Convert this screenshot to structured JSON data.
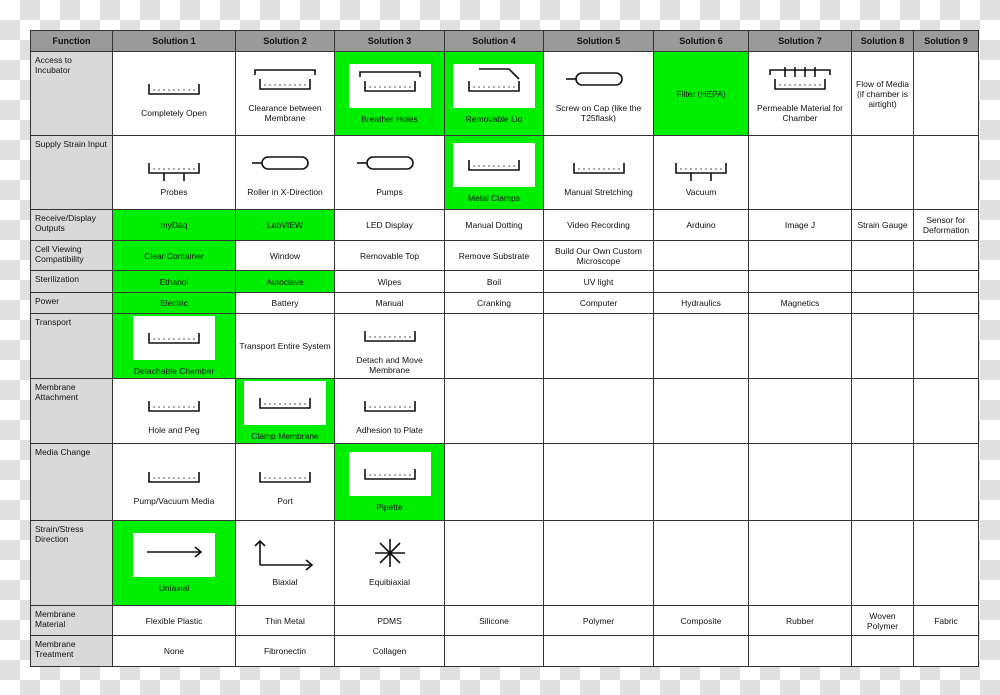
{
  "colors": {
    "selected": "#00ee00",
    "header": "#9a9a9a",
    "function_col": "#d9d9d9"
  },
  "headers": [
    "Function",
    "Solution 1",
    "Solution 2",
    "Solution 3",
    "Solution 4",
    "Solution 5",
    "Solution 6",
    "Solution 7",
    "Solution 8",
    "Solution 9"
  ],
  "rows": [
    {
      "label": "Access to Incubator",
      "cells": [
        {
          "text": "Completely Open",
          "sketch": "open-dish-icon"
        },
        {
          "text": "Clearance between Membrane",
          "sketch": "lidded-dish-icon"
        },
        {
          "text": "Breather Holes",
          "sketch": "vented-lid-dish-icon",
          "selected": true
        },
        {
          "text": "Removable Lid",
          "sketch": "hinged-lid-icon",
          "selected": true
        },
        {
          "text": "Screw on Cap (like the T25flask)",
          "sketch": "flask-icon"
        },
        {
          "text": "Filter (HEPA)",
          "selected": true
        },
        {
          "text": "Permeable Material for Chamber",
          "sketch": "permeable-chamber-icon"
        },
        {
          "text": "Flow of Media (if chamber is airtight)"
        },
        {
          "text": ""
        }
      ]
    },
    {
      "label": "Supply Strain Input",
      "cells": [
        {
          "text": "Probes",
          "sketch": "probe-icon"
        },
        {
          "text": "Roller in X-Direction",
          "sketch": "roller-icon"
        },
        {
          "text": "Pumps",
          "sketch": "pump-tube-icon"
        },
        {
          "text": "Metal Clamps",
          "sketch": "clamp-icon",
          "selected": true
        },
        {
          "text": "Manual Stretching",
          "sketch": "manual-stretch-icon"
        },
        {
          "text": "Vacuum",
          "sketch": "vacuum-icon"
        },
        {
          "text": ""
        },
        {
          "text": ""
        },
        {
          "text": ""
        }
      ]
    },
    {
      "label": "Receive/Display Outputs",
      "cells": [
        {
          "text": "myDaq",
          "selected": true
        },
        {
          "text": "LabVIEW",
          "selected": true
        },
        {
          "text": "LED Display"
        },
        {
          "text": "Manual Dotting"
        },
        {
          "text": "Video Recording"
        },
        {
          "text": "Arduino"
        },
        {
          "text": "Image J"
        },
        {
          "text": "Strain Gauge"
        },
        {
          "text": "Sensor for Deformation"
        }
      ]
    },
    {
      "label": "Cell Viewing Compatibility",
      "cells": [
        {
          "text": "Clear Container",
          "selected": true
        },
        {
          "text": "Window"
        },
        {
          "text": "Removable Top"
        },
        {
          "text": "Remove Substrate"
        },
        {
          "text": "Build Our Own Custom Microscope"
        },
        {
          "text": ""
        },
        {
          "text": ""
        },
        {
          "text": ""
        },
        {
          "text": ""
        }
      ]
    },
    {
      "label": "Sterilization",
      "cells": [
        {
          "text": "Ethanol",
          "selected": true
        },
        {
          "text": "Autoclave",
          "selected": true
        },
        {
          "text": "Wipes"
        },
        {
          "text": "Boil"
        },
        {
          "text": "UV light"
        },
        {
          "text": ""
        },
        {
          "text": ""
        },
        {
          "text": ""
        },
        {
          "text": ""
        }
      ]
    },
    {
      "label": "Power",
      "cells": [
        {
          "text": "Electric",
          "selected": true
        },
        {
          "text": "Battery"
        },
        {
          "text": "Manual"
        },
        {
          "text": "Cranking"
        },
        {
          "text": "Computer"
        },
        {
          "text": "Hydraulics"
        },
        {
          "text": "Magnetics"
        },
        {
          "text": ""
        },
        {
          "text": ""
        }
      ]
    },
    {
      "label": "Transport",
      "cells": [
        {
          "text": "Detachable Chamber",
          "sketch": "detach-chamber-icon",
          "selected": true
        },
        {
          "text": "Transport Entire System"
        },
        {
          "text": "Detach and Move Membrane",
          "sketch": "detach-membrane-icon"
        },
        {
          "text": ""
        },
        {
          "text": ""
        },
        {
          "text": ""
        },
        {
          "text": ""
        },
        {
          "text": ""
        },
        {
          "text": ""
        }
      ]
    },
    {
      "label": "Membrane Attachment",
      "cells": [
        {
          "text": "Hole and Peg",
          "sketch": "hole-peg-icon"
        },
        {
          "text": "Clamp Membrane",
          "sketch": "clamp-icon",
          "selected": true
        },
        {
          "text": "Adhesion to Plate",
          "sketch": "adhesion-icon"
        },
        {
          "text": ""
        },
        {
          "text": ""
        },
        {
          "text": ""
        },
        {
          "text": ""
        },
        {
          "text": ""
        },
        {
          "text": ""
        }
      ]
    },
    {
      "label": "Media Change",
      "cells": [
        {
          "text": "Pump/Vacuum Media",
          "sketch": "pump-media-icon"
        },
        {
          "text": "Port",
          "sketch": "port-icon"
        },
        {
          "text": "Pipette",
          "sketch": "pipette-icon",
          "selected": true
        },
        {
          "text": ""
        },
        {
          "text": ""
        },
        {
          "text": ""
        },
        {
          "text": ""
        },
        {
          "text": ""
        },
        {
          "text": ""
        }
      ]
    },
    {
      "label": "Strain/Stress Direction",
      "cells": [
        {
          "text": "Uniaxial",
          "sketch": "uniaxial-arrow-icon",
          "selected": true
        },
        {
          "text": "Biaxial",
          "sketch": "biaxial-arrows-icon"
        },
        {
          "text": "Equibiaxial",
          "sketch": "radial-arrows-icon"
        },
        {
          "text": ""
        },
        {
          "text": ""
        },
        {
          "text": ""
        },
        {
          "text": ""
        },
        {
          "text": ""
        },
        {
          "text": ""
        }
      ]
    },
    {
      "label": "Membrane Material",
      "cells": [
        {
          "text": "Flexible Plastic"
        },
        {
          "text": "Thin Metal"
        },
        {
          "text": "PDMS"
        },
        {
          "text": "Silicone"
        },
        {
          "text": "Polymer"
        },
        {
          "text": "Composite"
        },
        {
          "text": "Rubber"
        },
        {
          "text": "Woven Polymer"
        },
        {
          "text": "Fabric"
        }
      ]
    },
    {
      "label": "Membrane Treatment",
      "cells": [
        {
          "text": "None"
        },
        {
          "text": "Fibronectin"
        },
        {
          "text": "Collagen"
        },
        {
          "text": ""
        },
        {
          "text": ""
        },
        {
          "text": ""
        },
        {
          "text": ""
        },
        {
          "text": ""
        },
        {
          "text": ""
        }
      ]
    }
  ]
}
